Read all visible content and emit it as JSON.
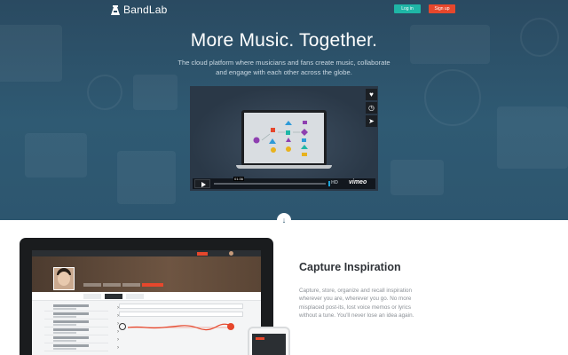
{
  "header": {
    "brand": "BandLab",
    "login_label": "Log in",
    "signup_label": "Sign up"
  },
  "hero": {
    "title": "More Music. Together.",
    "subtitle": "The cloud platform where musicians and fans create music, collaborate and engage with each other across the globe.",
    "video": {
      "time": "01:36",
      "hd_label": "HD",
      "provider": "vimeo",
      "side_icons": [
        "heart-icon",
        "clock-icon",
        "send-icon"
      ]
    }
  },
  "feature": {
    "title": "Capture Inspiration",
    "text": "Capture, store, organize and recall inspiration wherever you are, wherever you go. No more misplaced post-its, lost voice memos or lyrics without a tune. You'll never lose an idea again."
  },
  "colors": {
    "accent_green": "#1fb6a6",
    "accent_red": "#e6472c",
    "hero_bg": "#2f5a73"
  }
}
